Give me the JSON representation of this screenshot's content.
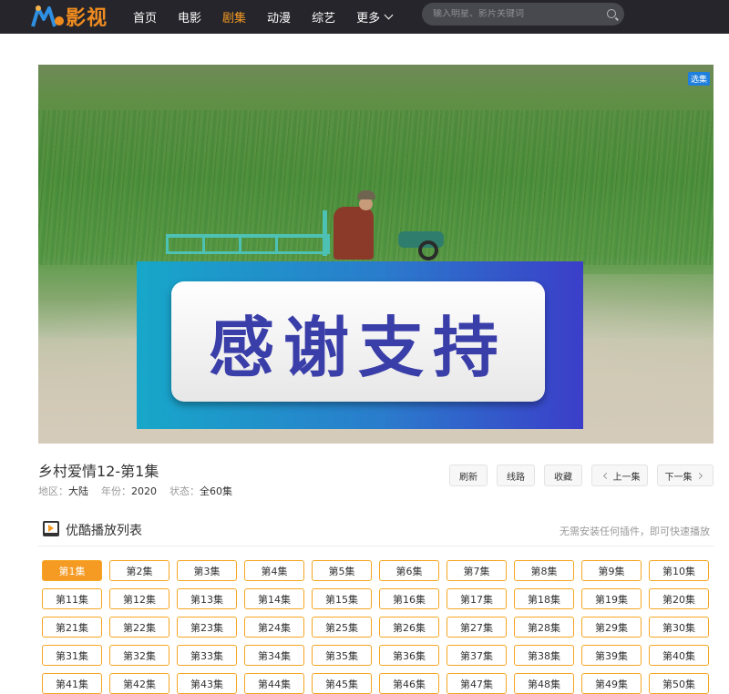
{
  "header": {
    "logo_text": "影视",
    "nav": [
      {
        "label": "首页",
        "active": false
      },
      {
        "label": "电影",
        "active": false
      },
      {
        "label": "剧集",
        "active": true
      },
      {
        "label": "动漫",
        "active": false
      },
      {
        "label": "综艺",
        "active": false
      },
      {
        "label": "更多",
        "active": false
      }
    ],
    "search_placeholder": "输入明星、影片关键词",
    "search_icon": "search-icon"
  },
  "player": {
    "overlay_text": "感谢支持",
    "episode_tag": "选集"
  },
  "info": {
    "title": "乡村爱情12-第1集",
    "meta": [
      {
        "label": "地区：",
        "value": "大陆"
      },
      {
        "label": "年份：",
        "value": "2020"
      },
      {
        "label": "状态：",
        "value": "全60集"
      }
    ]
  },
  "actions": {
    "refresh": "刷新",
    "route": "线路",
    "favorite": "收藏",
    "prev": "上一集",
    "next": "下一集"
  },
  "playlist": {
    "title": "优酷播放列表",
    "note": "无需安装任何插件，即可快速播放",
    "active_index": 0,
    "episodes": [
      "第1集",
      "第2集",
      "第3集",
      "第4集",
      "第5集",
      "第6集",
      "第7集",
      "第8集",
      "第9集",
      "第10集",
      "第11集",
      "第12集",
      "第13集",
      "第14集",
      "第15集",
      "第16集",
      "第17集",
      "第18集",
      "第19集",
      "第20集",
      "第21集",
      "第22集",
      "第23集",
      "第24集",
      "第25集",
      "第26集",
      "第27集",
      "第28集",
      "第29集",
      "第30集",
      "第31集",
      "第32集",
      "第33集",
      "第34集",
      "第35集",
      "第36集",
      "第37集",
      "第38集",
      "第39集",
      "第40集",
      "第41集",
      "第42集",
      "第43集",
      "第44集",
      "第45集",
      "第46集",
      "第47集",
      "第48集",
      "第49集",
      "第50集"
    ]
  },
  "colors": {
    "header_bg": "#25252b",
    "accent": "#f59a23",
    "episode_border": "#f5a623"
  }
}
